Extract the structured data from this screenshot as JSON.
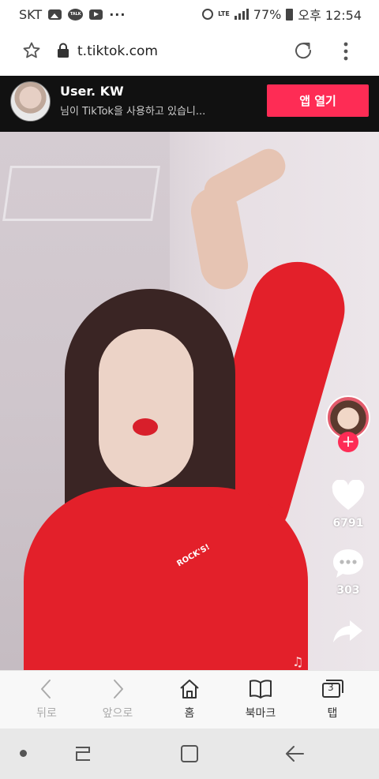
{
  "status_bar": {
    "carrier": "SKT",
    "talk_icon_text": "TALK",
    "more": "···",
    "network": "LTE",
    "battery": "77%",
    "time": "오후 12:54"
  },
  "browser": {
    "url": "t.tiktok.com"
  },
  "banner": {
    "username": "User. KW",
    "subtitle": "님이 TikTok을 사용하고 있습니...",
    "open_app_label": "앱 열기",
    "accent_color": "#fe2c55"
  },
  "video": {
    "shirt_logo": "ROCK'S!",
    "likes": "6791",
    "comments": "303",
    "follow_symbol": "+",
    "music_glyph": "♫"
  },
  "toolbar": {
    "items": [
      {
        "label": "뒤로",
        "icon": "chevron-left-icon",
        "enabled": false
      },
      {
        "label": "앞으로",
        "icon": "chevron-right-icon",
        "enabled": false
      },
      {
        "label": "홈",
        "icon": "home-icon",
        "enabled": true
      },
      {
        "label": "북마크",
        "icon": "book-icon",
        "enabled": true
      },
      {
        "label": "탭",
        "icon": "tabs-icon",
        "enabled": true
      }
    ],
    "tab_count": "3"
  }
}
